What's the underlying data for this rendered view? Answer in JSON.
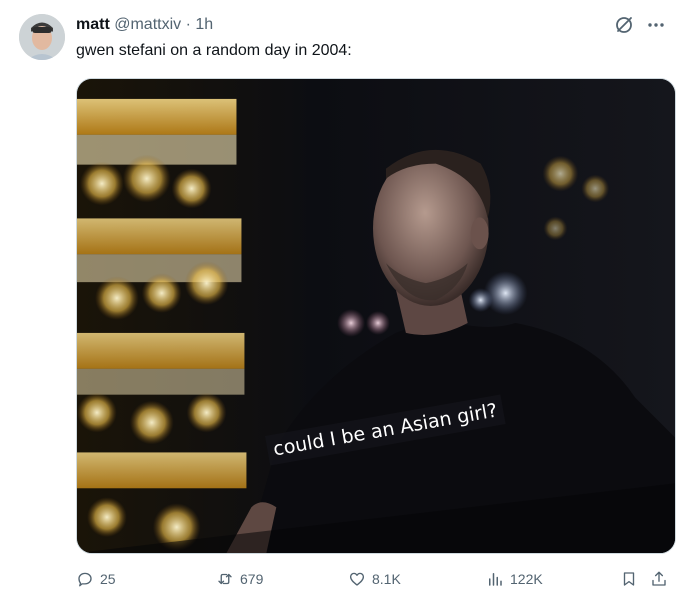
{
  "post": {
    "author": {
      "display_name": "matt",
      "handle": "@mattxiv",
      "separator": "·",
      "time": "1h",
      "avatar_icon": "profile-avatar-icon"
    },
    "text": "gwen stefani on a random day in 2004:",
    "media": {
      "subtitle": "could I be an Asian girl?",
      "type": "video-still"
    },
    "top_actions": {
      "grok_icon": "slash-circle-icon",
      "more_icon": "more-horizontal-icon"
    },
    "stats": {
      "replies": "25",
      "reposts": "679",
      "likes": "8.1K",
      "views": "122K"
    }
  },
  "colors": {
    "text_primary": "#0f1419",
    "text_secondary": "#536471",
    "border": "#cfd9de"
  }
}
